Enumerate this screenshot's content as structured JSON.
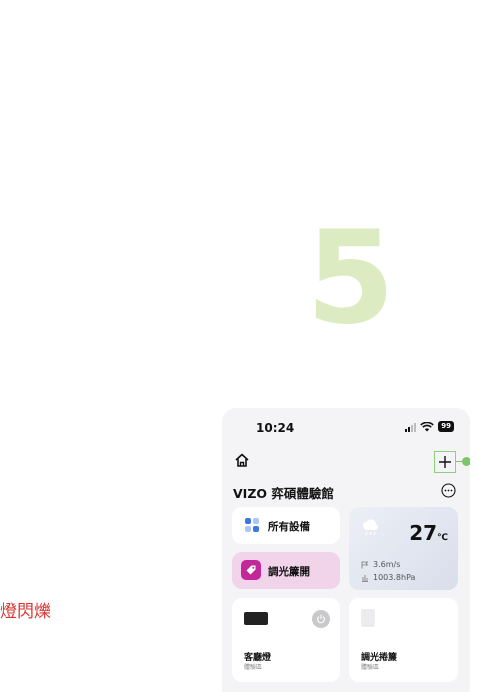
{
  "step_number": "5",
  "side_text": "燈閃爍",
  "status_bar": {
    "time": "10:24",
    "battery": "99"
  },
  "header": {
    "title": "VIZO 弈碩體驗館"
  },
  "cards": {
    "all_devices": {
      "label": "所有設備"
    },
    "dimmer_curtain": {
      "label": "調光簾開"
    },
    "weather": {
      "temperature": "27",
      "unit": "℃",
      "wind": "3.6m/s",
      "pressure": "1003.8hPa"
    }
  },
  "devices": [
    {
      "name": "客廳燈",
      "room": "體驗區",
      "icon": "dark-panel-icon"
    },
    {
      "name": "調光捲簾",
      "room": "體驗區",
      "icon": "curtain-icon"
    }
  ],
  "colors": {
    "accent_green": "#7cc66a",
    "step_number": "#dcebc2",
    "side_text": "#d9362f",
    "tag_magenta": "#c3289b"
  }
}
